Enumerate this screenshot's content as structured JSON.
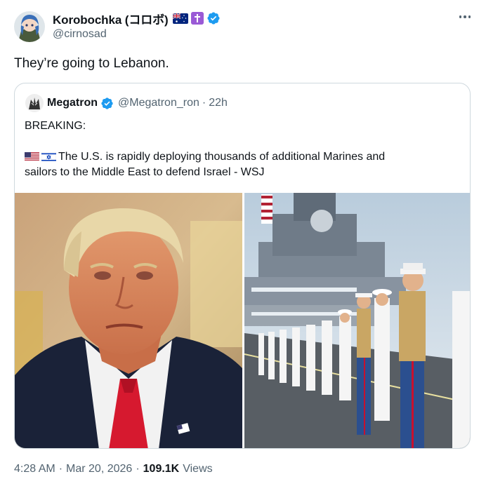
{
  "author": {
    "display_name": "Korobochka (コロボ)",
    "handle": "@cirnosad"
  },
  "tweet": {
    "text": "They’re going to Lebanon."
  },
  "quote": {
    "display_name": "Megatron",
    "handle": "@Megatron_ron",
    "separator": "·",
    "time": "22h",
    "line1": "BREAKING:",
    "line2": "The U.S. is rapidly deploying thousands of additional Marines and",
    "line3": "sailors to the Middle East to defend Israel - WSJ",
    "flags": [
      "us-flag",
      "israel-flag"
    ]
  },
  "meta": {
    "time": "4:28 AM",
    "sep1": "·",
    "date": "Mar 20, 2026",
    "sep2": "·",
    "views_count": "109.1K",
    "views_label": "Views"
  },
  "colors": {
    "verified": "#1d9bf0",
    "secondary_text": "#536471",
    "border": "#cfd9de",
    "badge_purple": "#9a5ad6"
  },
  "icons": [
    "australia-flag-icon",
    "cross-badge-icon",
    "verified-badge-icon",
    "more-options-icon"
  ]
}
